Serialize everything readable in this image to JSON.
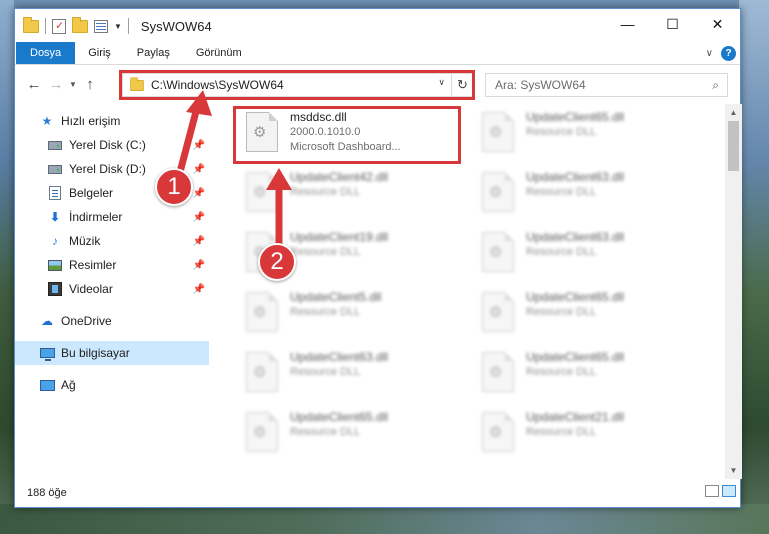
{
  "window": {
    "title": "SysWOW64"
  },
  "title_buttons": {
    "minimize": "—",
    "maximize": "☐",
    "close": "✕"
  },
  "ribbon": {
    "tabs": [
      "Dosya",
      "Giriş",
      "Paylaş",
      "Görünüm"
    ],
    "help": "?"
  },
  "address": {
    "path": "C:\\Windows\\SysWOW64",
    "search_placeholder": "Ara: SysWOW64"
  },
  "sidebar": {
    "items": [
      {
        "label": "Hızlı erişim",
        "icon": "star-icon"
      },
      {
        "label": "Yerel Disk (C:)",
        "icon": "disk-icon",
        "pinned": true
      },
      {
        "label": "Yerel Disk (D:)",
        "icon": "disk-icon",
        "pinned": true
      },
      {
        "label": "Belgeler",
        "icon": "document-icon",
        "pinned": true
      },
      {
        "label": "İndirmeler",
        "icon": "download-icon",
        "pinned": true
      },
      {
        "label": "Müzik",
        "icon": "music-icon",
        "pinned": true
      },
      {
        "label": "Resimler",
        "icon": "pictures-icon",
        "pinned": true
      },
      {
        "label": "Videolar",
        "icon": "video-icon",
        "pinned": true
      },
      {
        "label": "OneDrive",
        "icon": "cloud-icon"
      },
      {
        "label": "Bu bilgisayar",
        "icon": "computer-icon",
        "selected": true
      },
      {
        "label": "Ağ",
        "icon": "network-icon"
      }
    ]
  },
  "files": [
    {
      "name": "msddsc.dll",
      "line2": "2000.0.1010.0",
      "line3": "Microsoft Dashboard..."
    },
    {
      "name": "UpdateClient65.dll",
      "line2": "Resource DLL"
    },
    {
      "name": "UpdateClient42.dll",
      "line2": "Resource DLL"
    },
    {
      "name": "UpdateClient63.dll",
      "line2": "Resource DLL"
    },
    {
      "name": "UpdateClient19.dll",
      "line2": "Resource DLL"
    },
    {
      "name": "UpdateClient63.dll",
      "line2": "Resource DLL"
    },
    {
      "name": "UpdateClient5.dll",
      "line2": "Resource DLL"
    },
    {
      "name": "UpdateClient65.dll",
      "line2": "Resource DLL"
    },
    {
      "name": "UpdateClient63.dll",
      "line2": "Resource DLL"
    },
    {
      "name": "UpdateClient65.dll",
      "line2": "Resource DLL"
    },
    {
      "name": "UpdateClient65.dll",
      "line2": "Resource DLL"
    },
    {
      "name": "UpdateClient21.dll",
      "line2": "Resource DLL"
    }
  ],
  "status": {
    "item_count": "188 öğe"
  },
  "annotations": {
    "step1": "1",
    "step2": "2",
    "color": "#d9383a"
  },
  "colors": {
    "accent": "#1979ca",
    "selection": "#cce8ff"
  }
}
